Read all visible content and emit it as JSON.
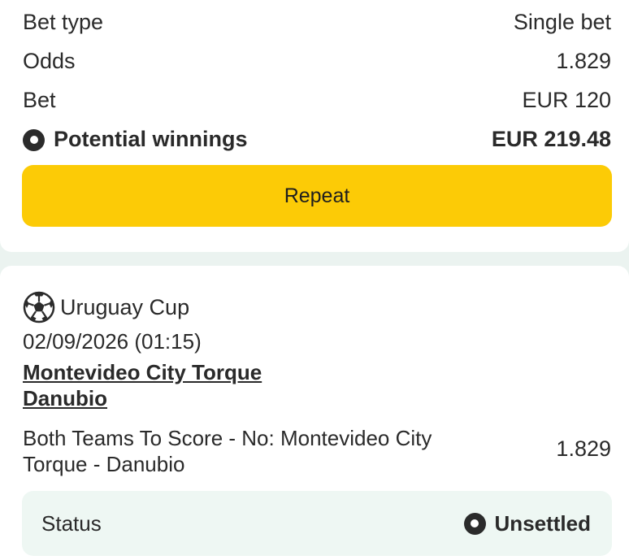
{
  "summary": {
    "bet_type_label": "Bet type",
    "bet_type_value": "Single bet",
    "odds_label": "Odds",
    "odds_value": "1.829",
    "bet_label": "Bet",
    "bet_value": "EUR 120",
    "potential_label": "Potential winnings",
    "potential_value": "EUR 219.48",
    "repeat_label": "Repeat"
  },
  "selection": {
    "sport_icon": "soccer-ball-icon",
    "league": "Uruguay Cup",
    "datetime": "02/09/2026 (01:15)",
    "match_line1": "Montevideo City Torque",
    "match_line2": "Danubio",
    "market_line1": "Both Teams To Score - No: Montevideo City",
    "market_line2": "Torque - Danubio",
    "odds": "1.829",
    "status_label": "Status",
    "status_value": "Unsettled"
  },
  "colors": {
    "accent": "#fccb06",
    "background": "#ebf3f0",
    "status_bg": "#eef7f3"
  }
}
